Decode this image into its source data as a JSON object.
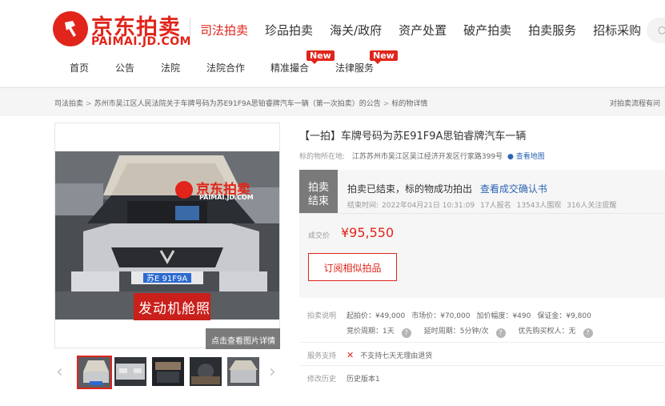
{
  "brand": {
    "logo_text": "京东拍卖",
    "logo_url": "PAIMAI.JD.COM",
    "color": "#e1251b"
  },
  "main_nav": [
    {
      "label": "司法拍卖",
      "active": true
    },
    {
      "label": "珍品拍卖"
    },
    {
      "label": "海关/政府"
    },
    {
      "label": "资产处置"
    },
    {
      "label": "破产拍卖"
    },
    {
      "label": "拍卖服务"
    },
    {
      "label": "招标采购"
    }
  ],
  "sub_nav": [
    {
      "label": "首页"
    },
    {
      "label": "公告"
    },
    {
      "label": "法院"
    },
    {
      "label": "法院合作"
    },
    {
      "label": "精准撮合",
      "badge": "New"
    },
    {
      "label": "法律服务",
      "badge": "New"
    }
  ],
  "breadcrumb": {
    "items": [
      "司法拍卖",
      "苏州市吴江区人民法院关于车牌号码为苏E91F9A思铂睿牌汽车一辆（第一次拍卖）的公告",
      "标的物详情"
    ],
    "right_text": "对拍卖流程有问"
  },
  "gallery": {
    "watermark_text": "京东拍卖",
    "watermark_url": "PAIMAI.JD.COM",
    "plate_text": "苏E 91F9A",
    "caption": "发动机舱照",
    "detail_button": "点击查看图片详情",
    "thumb_prev": "‹",
    "thumb_next": "›"
  },
  "item": {
    "title": "【一拍】车牌号码为苏E91F9A思铂睿牌汽车一辆",
    "location_label": "标的物所在地:",
    "location": "江苏苏州市吴江区吴江经济开发区行家路399号",
    "map_link": "查看地图"
  },
  "status": {
    "tag_line1": "拍卖",
    "tag_line2": "结束",
    "message": "拍卖已结束，标的物成功拍出",
    "confirm_link": "查看成交确认书",
    "end_time_label": "结束时间:",
    "end_time": "2022年04月21日 10:31:09",
    "signups": "17人报名",
    "views": "13543人围观",
    "followers": "316人关注提醒",
    "deal_price_label": "成交价",
    "deal_price": "¥95,550",
    "subscribe_button": "订阅相似拍品"
  },
  "auction_info": {
    "label": "拍卖说明",
    "start_price": "起拍价：¥49,000",
    "market_price": "市场价：¥70,000",
    "increment": "加价幅度：¥490",
    "deposit": "保证金：¥9,800",
    "bid_period": "竞价周期：1天",
    "delay_period": "延时周期：5分钟/次",
    "priority_buyer": "优先购买权人：无",
    "question_mark": "?"
  },
  "service": {
    "label": "服务支持",
    "item": "不支持七天无理由退货",
    "x_mark": "✕"
  },
  "history": {
    "label": "修改历史",
    "item": "历史版本1"
  }
}
